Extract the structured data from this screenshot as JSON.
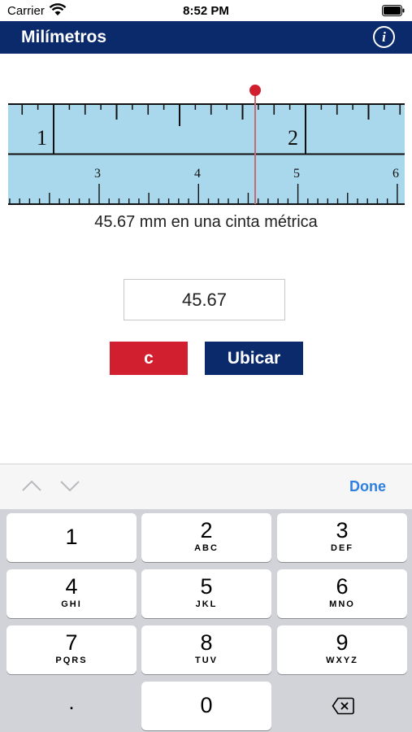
{
  "status_bar": {
    "carrier": "Carrier",
    "time": "8:52 PM"
  },
  "nav": {
    "title": "Milímetros",
    "info_icon": "i"
  },
  "ruler": {
    "upper_labels": [
      "1",
      "2"
    ],
    "lower_labels": [
      "3",
      "4",
      "5",
      "6"
    ],
    "marker_value_mm": 45.67,
    "colors": {
      "band": "#a9d7ec",
      "marker": "#d11f2f",
      "needle": "#c86a76"
    }
  },
  "caption": "45.67 mm en una cinta métrica",
  "input": {
    "value": "45.67"
  },
  "buttons": {
    "clear": "c",
    "locate": "Ubicar"
  },
  "accessory": {
    "done": "Done"
  },
  "keypad": {
    "keys": [
      {
        "num": "1",
        "letters": ""
      },
      {
        "num": "2",
        "letters": "ABC"
      },
      {
        "num": "3",
        "letters": "DEF"
      },
      {
        "num": "4",
        "letters": "GHI"
      },
      {
        "num": "5",
        "letters": "JKL"
      },
      {
        "num": "6",
        "letters": "MNO"
      },
      {
        "num": "7",
        "letters": "PQRS"
      },
      {
        "num": "8",
        "letters": "TUV"
      },
      {
        "num": "9",
        "letters": "WXYZ"
      }
    ],
    "zero": "0",
    "dot": ".",
    "backspace_icon": "delete-icon"
  }
}
